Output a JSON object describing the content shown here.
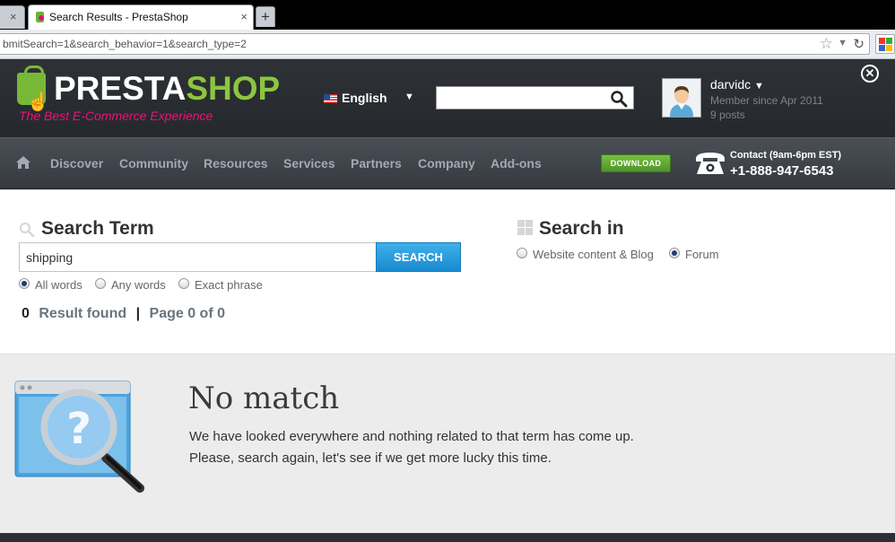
{
  "browser": {
    "tab_inactive_close": "×",
    "tab_title": "Search Results - PrestaShop",
    "tab_close": "×",
    "new_tab": "+",
    "url": "bmitSearch=1&search_behavior=1&search_type=2",
    "star": "☆",
    "reload": "↻"
  },
  "header": {
    "logo_part1": "PRESTA",
    "logo_part2": "SHOP",
    "tagline": "The Best E-Commerce Experience",
    "language": "English",
    "language_caret": "▼",
    "search_value": "",
    "user_name": "darvidc",
    "user_caret": "▼",
    "member_since": "Member since Apr 2011",
    "posts": "9 posts",
    "close": "✕"
  },
  "nav": {
    "items": [
      "Discover",
      "Community",
      "Resources",
      "Services",
      "Partners",
      "Company",
      "Add-ons"
    ],
    "download": "DOWNLOAD",
    "contact_label": "Contact (9am-6pm EST)",
    "contact_phone": "+1-888-947-6543"
  },
  "search": {
    "title": "Search Term",
    "term": "shipping",
    "button": "SEARCH",
    "match_options": [
      {
        "label": "All words",
        "selected": true
      },
      {
        "label": "Any words",
        "selected": false
      },
      {
        "label": "Exact phrase",
        "selected": false
      }
    ],
    "result_count": "0",
    "result_label": "Result found",
    "separator": "|",
    "page_label": "Page 0 of 0",
    "search_in_title": "Search in",
    "search_in_options": [
      {
        "label": "Website content & Blog",
        "selected": false
      },
      {
        "label": "Forum",
        "selected": true
      }
    ]
  },
  "no_match": {
    "title": "No match",
    "line1": "We have looked everywhere and nothing related to that term has come up.",
    "line2": "Please, search again, let's see if we get more lucky this time."
  },
  "colors": {
    "accent_green": "#8cc63f",
    "accent_pink": "#e4157b",
    "search_blue": "#1a8ad0",
    "header_dark": "#2e3237"
  }
}
